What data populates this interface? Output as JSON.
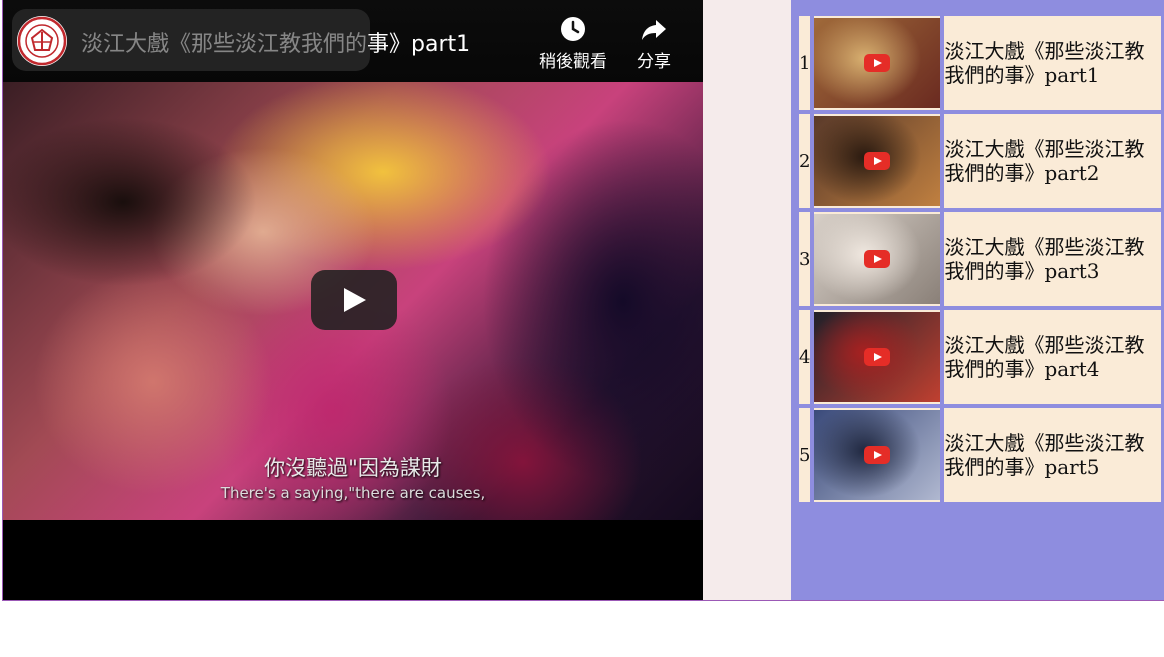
{
  "player": {
    "title_visible": "淡江大戲《那些淡江教我們的",
    "title_tail": "事》part1",
    "watch_later_label": "稍後觀看",
    "share_label": "分享",
    "subtitle_zh": "你沒聽過\"因為謀財",
    "subtitle_en": "There's a saying,\"there are causes,"
  },
  "playlist": {
    "items": [
      {
        "index": "1",
        "title": "淡江大戲《那些淡江教我們的事》part1",
        "thumb_colors": [
          "#a06a3a",
          "#6a2a20",
          "#d8b070"
        ]
      },
      {
        "index": "2",
        "title": "淡江大戲《那些淡江教我們的事》part2",
        "thumb_colors": [
          "#5a3a2a",
          "#c08040",
          "#2a1a10"
        ]
      },
      {
        "index": "3",
        "title": "淡江大戲《那些淡江教我們的事》part3",
        "thumb_colors": [
          "#d8d0c8",
          "#8a8078",
          "#f0e8e0"
        ]
      },
      {
        "index": "4",
        "title": "淡江大戲《那些淡江教我們的事》part4",
        "thumb_colors": [
          "#20202a",
          "#c04030",
          "#a82020"
        ]
      },
      {
        "index": "5",
        "title": "淡江大戲《那些淡江教我們的事》part5",
        "thumb_colors": [
          "#3a4a7a",
          "#b0b8d0",
          "#202840"
        ]
      }
    ]
  },
  "colors": {
    "panel": "#8e8ddf",
    "cell": "#faebd7",
    "youtube_red": "#e52d27"
  }
}
